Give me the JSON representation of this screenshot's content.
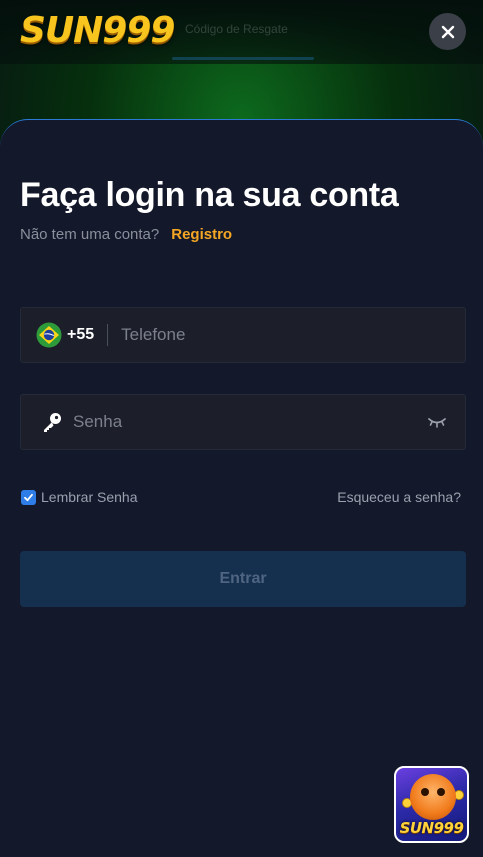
{
  "header": {
    "logo_text": "SUN999",
    "nav_items": [
      "Código de Resgate"
    ],
    "close_icon": "close-icon"
  },
  "login": {
    "title": "Faça login na sua conta",
    "no_account_text": "Não tem uma conta?",
    "register_link": "Registro",
    "phone": {
      "flag_icon": "brazil-flag-icon",
      "country_code": "+55",
      "placeholder": "Telefone",
      "value": ""
    },
    "password": {
      "key_icon": "key-icon",
      "placeholder": "Senha",
      "value": "",
      "toggle_icon": "eye-closed-icon"
    },
    "remember": {
      "label": "Lembrar Senha",
      "checked": true
    },
    "forgot_link": "Esqueceu a senha?",
    "submit_label": "Entrar"
  },
  "promo_badge": {
    "logo_text": "SUN999"
  },
  "colors": {
    "accent_orange": "#f5a623",
    "accent_blue": "#2f7ee8",
    "modal_bg": "#13182b",
    "field_bg": "#1c1f2a",
    "submit_bg": "#15304f",
    "logo_gold": "#f7c51e"
  }
}
